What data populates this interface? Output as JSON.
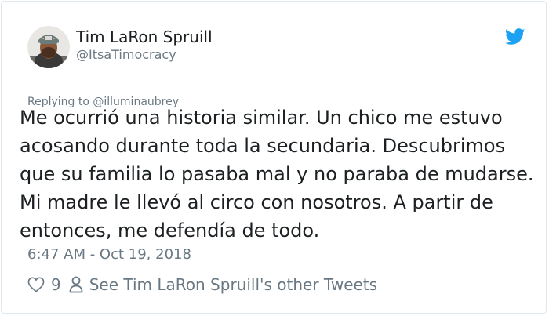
{
  "tweet": {
    "display_name": "Tim LaRon Spruill",
    "handle": "@ItsaTimocracy",
    "replying_to": "Replying to @illuminaubrey",
    "text": "Me ocurrió una historia similar. Un chico me estuvo\nacosando durante toda la secundaria. Descubrimos\nque su familia lo pasaba mal y no paraba de mudarse.\nMi madre le llevó al circo con nosotros. A partir de\nentonces, me defendía de todo.",
    "timestamp": "6:47 AM - Oct 19, 2018",
    "like_count": "9",
    "see_more": "See Tim LaRon Spruill's other Tweets"
  },
  "icons": {
    "brand": "twitter-bird-icon",
    "like": "heart-icon",
    "profile": "person-icon"
  },
  "colors": {
    "twitter_blue": "#1da1f2",
    "text_primary": "#1c2022",
    "text_secondary": "#697882",
    "border": "#e1e8ed"
  }
}
